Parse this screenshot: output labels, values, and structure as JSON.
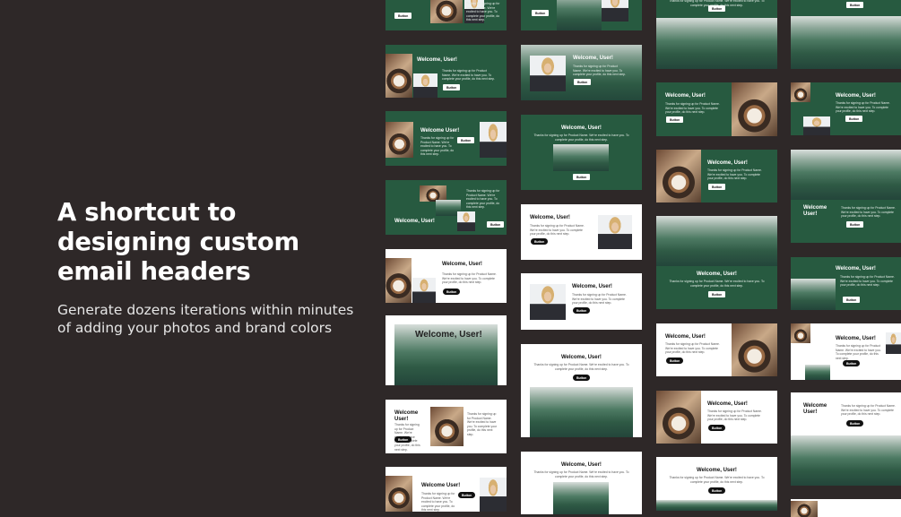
{
  "hero": {
    "headline": "A shortcut to designing custom email headers",
    "subhead": "Generate dozens iterations within minutes of adding your photos and brand colors"
  },
  "email": {
    "welcome": "Welcome, User!",
    "welcome_alt": "Welcome User!",
    "body": "Thanks for signing up for Product Name. We're excited to have you. To complete your profile, do this next step.",
    "button": "Button"
  },
  "colors": {
    "background": "#2e2828",
    "brand_green": "#275a40",
    "white": "#ffffff",
    "button_dark": "#111111"
  }
}
